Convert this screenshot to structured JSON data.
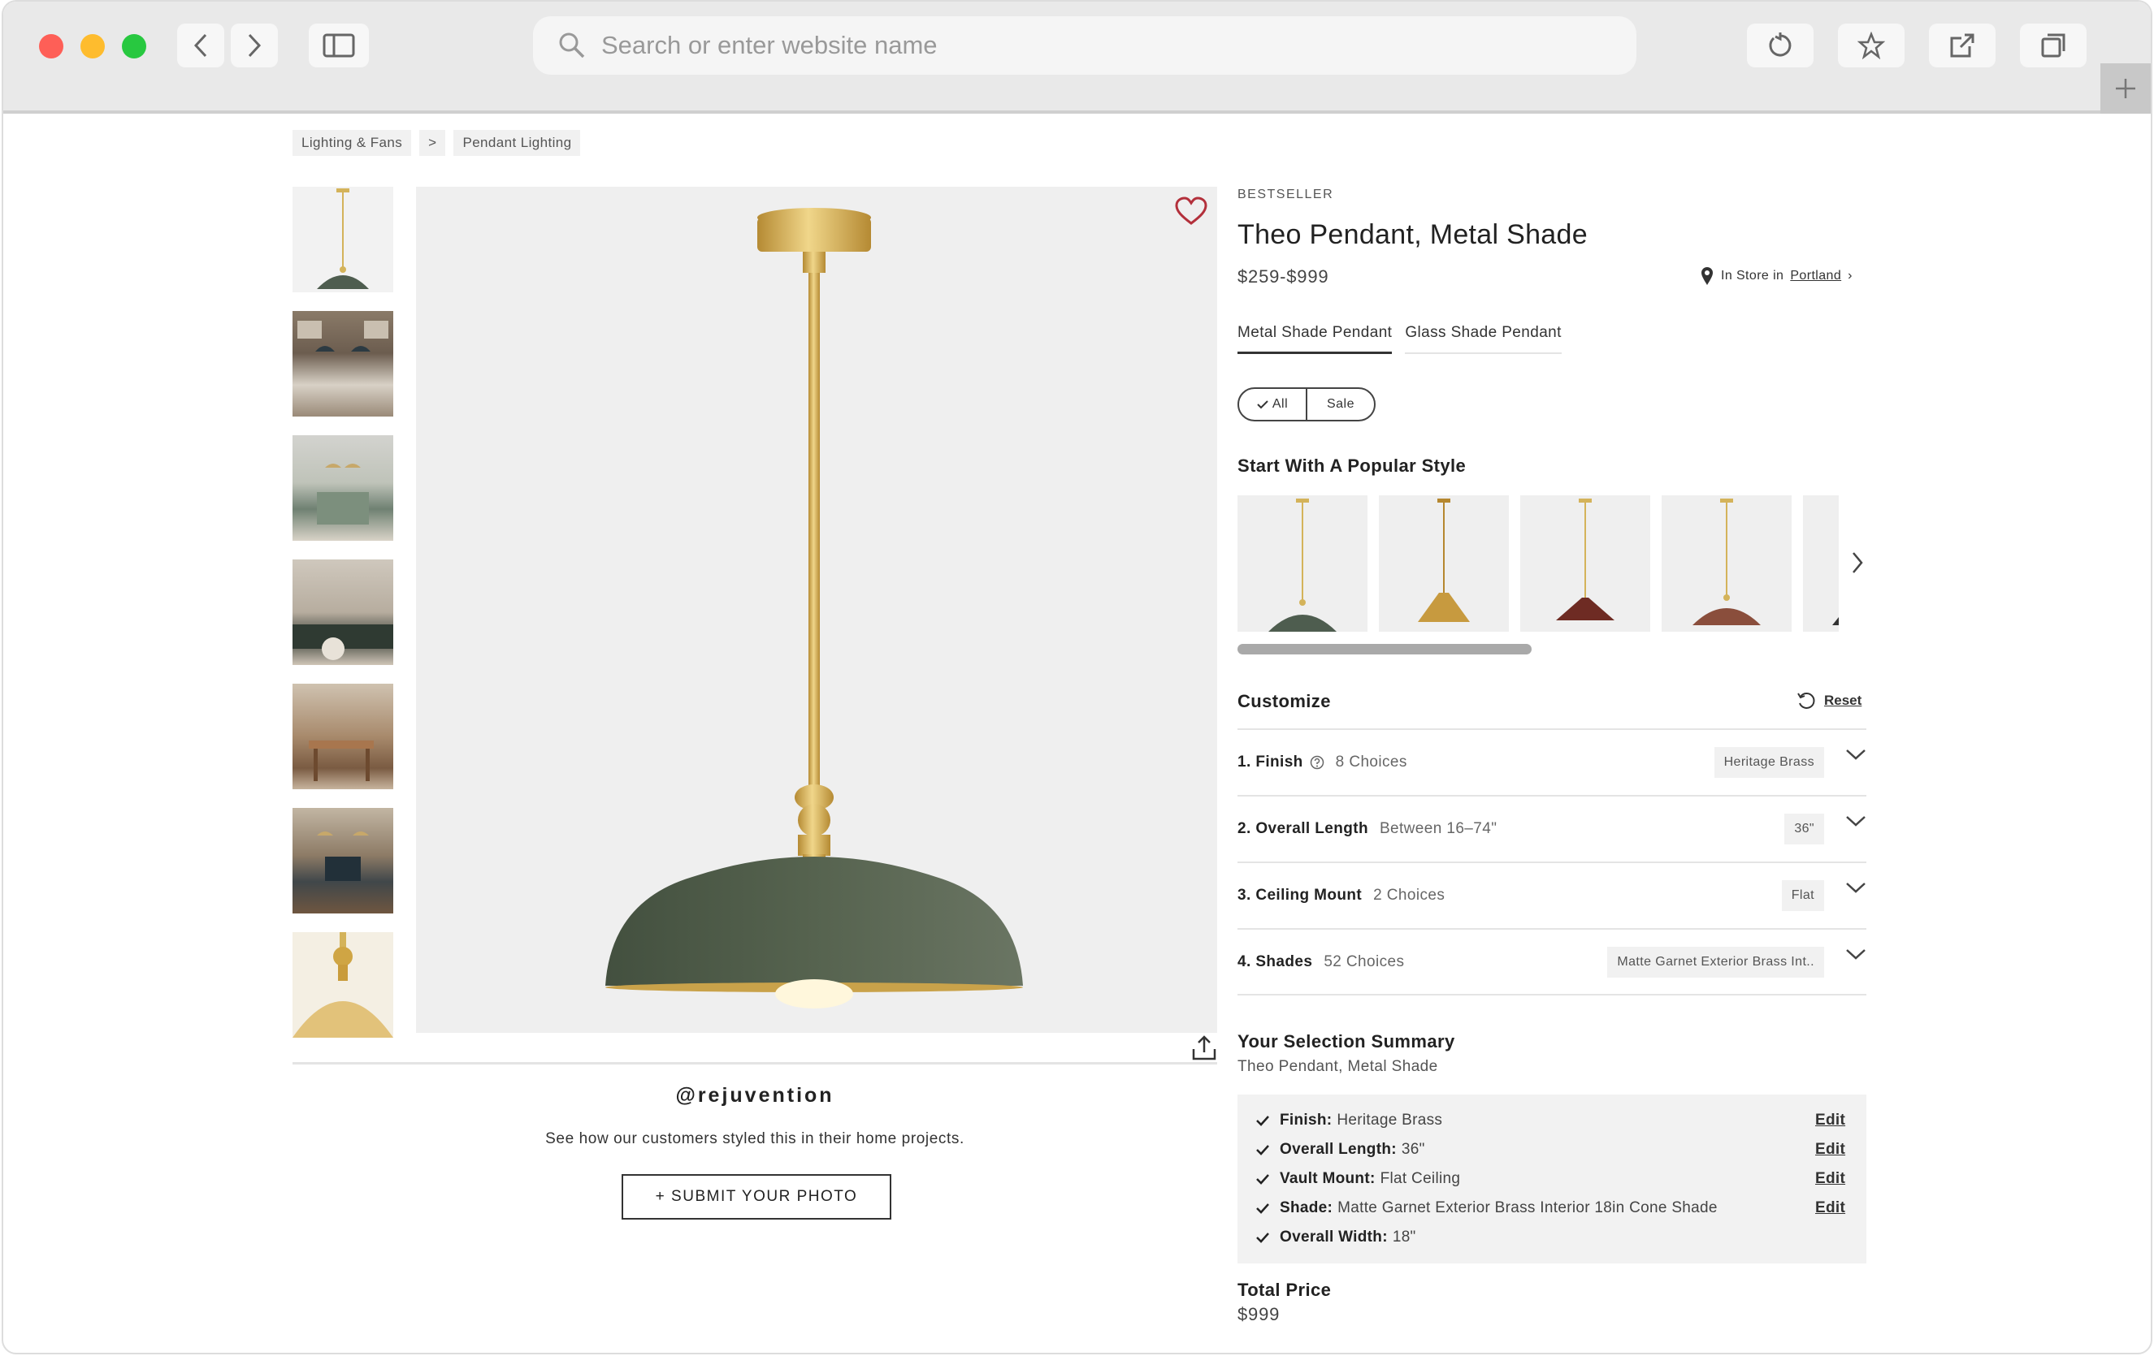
{
  "browser": {
    "search_placeholder": "Search or enter website name",
    "traffic_colors": [
      "#fe5f57",
      "#febc2e",
      "#28c840"
    ]
  },
  "breadcrumb": [
    "Lighting & Fans",
    ">",
    "Pendant Lighting"
  ],
  "ugc": {
    "handle": "@rejuvention",
    "description": "See how our customers styled this in their home projects.",
    "submit_label": "+ SUBMIT YOUR PHOTO"
  },
  "product": {
    "badge": "BESTSELLER",
    "title": "Theo Pendant, Metal Shade",
    "price": "$259-$999",
    "store_prefix": "In Store in",
    "store_name": "Portland",
    "store_suffix": "›",
    "tabs": [
      "Metal Shade Pendant",
      "Glass Shade Pendant"
    ],
    "filters": {
      "all": "All",
      "sale": "Sale"
    }
  },
  "popular": {
    "title": "Start With A Popular Style",
    "shade_colors": [
      "#4e5d4f",
      "#c79a3f",
      "#6e2b23",
      "#8a4e3c"
    ]
  },
  "customize": {
    "title": "Customize",
    "reset_label": "Reset",
    "options": [
      {
        "label": "1.  Finish",
        "sub": "8 Choices",
        "value": "Heritage Brass"
      },
      {
        "label": "2.  Overall Length",
        "sub": "Between 16–74\"",
        "value": "36\""
      },
      {
        "label": "3.  Ceiling Mount",
        "sub": "2 Choices",
        "value": "Flat"
      },
      {
        "label": "4.  Shades",
        "sub": "52 Choices",
        "value": "Matte Garnet Exterior Brass Int.."
      }
    ]
  },
  "summary": {
    "title": "Your Selection Summary",
    "subtitle": "Theo Pendant, Metal Shade",
    "edit_label": "Edit",
    "rows": [
      {
        "key": "Finish:",
        "value": "Heritage Brass",
        "editable": true
      },
      {
        "key": "Overall Length:",
        "value": "36\"",
        "editable": true
      },
      {
        "key": "Vault Mount:",
        "value": "Flat Ceiling",
        "editable": true
      },
      {
        "key": "Shade:",
        "value": "Matte Garnet Exterior Brass Interior 18in Cone Shade",
        "editable": true
      },
      {
        "key": "Overall Width:",
        "value": "18\"",
        "editable": false
      }
    ]
  },
  "total": {
    "title": "Total Price",
    "value": "$999"
  }
}
